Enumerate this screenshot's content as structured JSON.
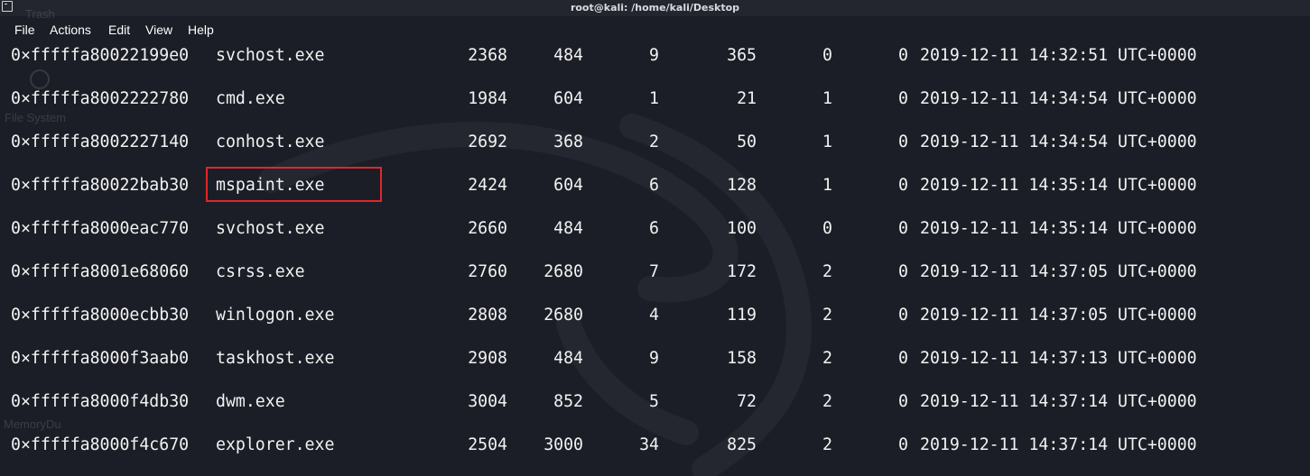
{
  "window": {
    "title": "root@kali: /home/kali/Desktop"
  },
  "menu": [
    "File",
    "Actions",
    "Edit",
    "View",
    "Help"
  ],
  "desktop_ghost_labels": [
    "Trash",
    "File System",
    "MemoryDu"
  ],
  "rows": [
    {
      "offset": "0×fffffa80022199e0",
      "name": "svchost.exe",
      "pid": "2368",
      "ppid": "484",
      "thds": "9",
      "hnds": "365",
      "sess": "0",
      "wow64": "0",
      "start": "2019-12-11 14:32:51 UTC+0000"
    },
    {
      "offset": "0×fffffa8002222780",
      "name": "cmd.exe",
      "pid": "1984",
      "ppid": "604",
      "thds": "1",
      "hnds": "21",
      "sess": "1",
      "wow64": "0",
      "start": "2019-12-11 14:34:54 UTC+0000"
    },
    {
      "offset": "0×fffffa8002227140",
      "name": "conhost.exe",
      "pid": "2692",
      "ppid": "368",
      "thds": "2",
      "hnds": "50",
      "sess": "1",
      "wow64": "0",
      "start": "2019-12-11 14:34:54 UTC+0000"
    },
    {
      "offset": "0×fffffa80022bab30",
      "name": "mspaint.exe",
      "pid": "2424",
      "ppid": "604",
      "thds": "6",
      "hnds": "128",
      "sess": "1",
      "wow64": "0",
      "start": "2019-12-11 14:35:14 UTC+0000"
    },
    {
      "offset": "0×fffffa8000eac770",
      "name": "svchost.exe",
      "pid": "2660",
      "ppid": "484",
      "thds": "6",
      "hnds": "100",
      "sess": "0",
      "wow64": "0",
      "start": "2019-12-11 14:35:14 UTC+0000"
    },
    {
      "offset": "0×fffffa8001e68060",
      "name": "csrss.exe",
      "pid": "2760",
      "ppid": "2680",
      "thds": "7",
      "hnds": "172",
      "sess": "2",
      "wow64": "0",
      "start": "2019-12-11 14:37:05 UTC+0000"
    },
    {
      "offset": "0×fffffa8000ecbb30",
      "name": "winlogon.exe",
      "pid": "2808",
      "ppid": "2680",
      "thds": "4",
      "hnds": "119",
      "sess": "2",
      "wow64": "0",
      "start": "2019-12-11 14:37:05 UTC+0000"
    },
    {
      "offset": "0×fffffa8000f3aab0",
      "name": "taskhost.exe",
      "pid": "2908",
      "ppid": "484",
      "thds": "9",
      "hnds": "158",
      "sess": "2",
      "wow64": "0",
      "start": "2019-12-11 14:37:13 UTC+0000"
    },
    {
      "offset": "0×fffffa8000f4db30",
      "name": "dwm.exe",
      "pid": "3004",
      "ppid": "852",
      "thds": "5",
      "hnds": "72",
      "sess": "2",
      "wow64": "0",
      "start": "2019-12-11 14:37:14 UTC+0000"
    },
    {
      "offset": "0×fffffa8000f4c670",
      "name": "explorer.exe",
      "pid": "2504",
      "ppid": "3000",
      "thds": "34",
      "hnds": "825",
      "sess": "2",
      "wow64": "0",
      "start": "2019-12-11 14:37:14 UTC+0000"
    }
  ],
  "highlighted_row": 3,
  "colors": {
    "background": "#1b1e26",
    "text": "#f2f2f2",
    "highlight_box": "#e0262b"
  }
}
